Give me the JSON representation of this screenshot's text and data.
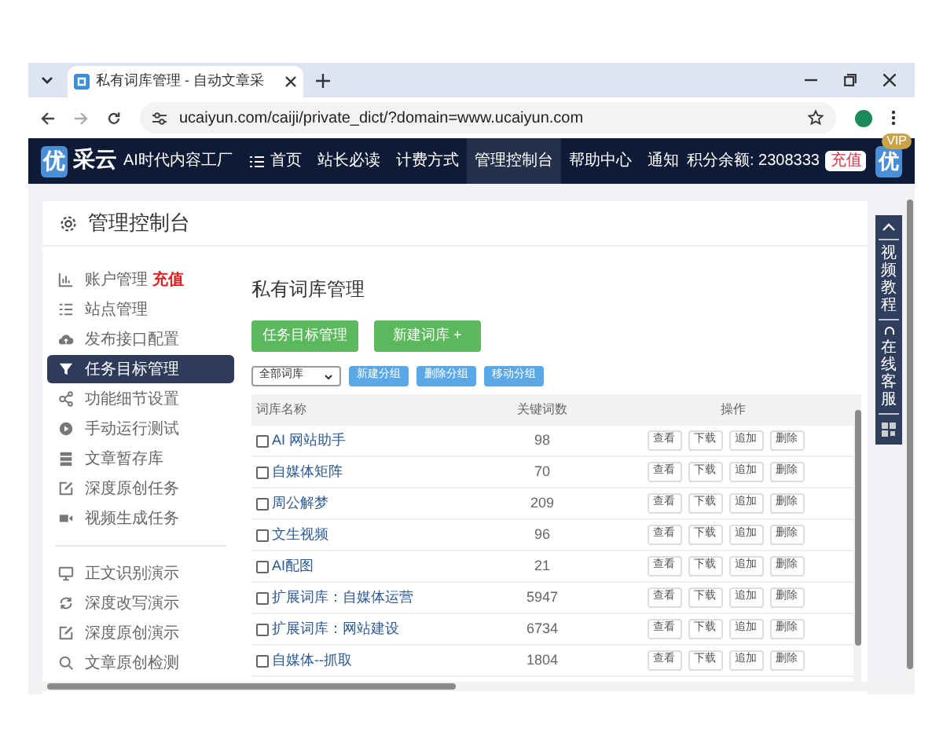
{
  "browser": {
    "tab_title": "私有词库管理 - 自动文章采",
    "url": "ucaiyun.com/caiji/private_dict/?domain=www.ucaiyun.com"
  },
  "nav": {
    "logo_mark": "优",
    "logo_text": "采云",
    "slogan": "AI时代内容工厂",
    "items": [
      {
        "label": "首页",
        "selected": false
      },
      {
        "label": "站长必读",
        "selected": false
      },
      {
        "label": "计费方式",
        "selected": false
      },
      {
        "label": "管理控制台",
        "selected": true
      },
      {
        "label": "帮助中心",
        "selected": false
      },
      {
        "label": "通知",
        "selected": false
      }
    ],
    "balance": "积分余额: 2308333",
    "recharge": "充值",
    "vip_badge": "VIP",
    "avatar": "优"
  },
  "sidebar": {
    "title": "管理控制台",
    "sections": [
      {
        "items": [
          {
            "label": "账户管理",
            "badge": "充值",
            "selected": false
          },
          {
            "label": "站点管理",
            "selected": false
          },
          {
            "label": "发布接口配置",
            "selected": false
          },
          {
            "label": "任务目标管理",
            "selected": true
          },
          {
            "label": "功能细节设置",
            "selected": false
          },
          {
            "label": "手动运行测试",
            "selected": false
          },
          {
            "label": "文章暂存库",
            "selected": false
          },
          {
            "label": "深度原创任务",
            "selected": false
          },
          {
            "label": "视频生成任务",
            "selected": false
          }
        ]
      },
      {
        "items": [
          {
            "label": "正文识别演示",
            "selected": false
          },
          {
            "label": "深度改写演示",
            "selected": false
          },
          {
            "label": "深度原创演示",
            "selected": false
          },
          {
            "label": "文章原创检测",
            "selected": false
          }
        ]
      }
    ]
  },
  "main": {
    "title": "私有词库管理",
    "buttons": [
      "任务目标管理",
      "新建词库 +"
    ],
    "filter": {
      "value": "全部词库"
    },
    "group_buttons": [
      "新建分组",
      "删除分组",
      "移动分组"
    ],
    "table": {
      "columns": [
        "词库名称",
        "关键词数",
        "操作"
      ],
      "rows": [
        {
          "name": "AI 网站助手",
          "count": "98",
          "checked": false,
          "actions": [
            "查看",
            "下载",
            "追加",
            "删除"
          ]
        },
        {
          "name": "自媒体矩阵",
          "count": "70",
          "checked": false,
          "actions": [
            "查看",
            "下载",
            "追加",
            "删除"
          ]
        },
        {
          "name": "周公解梦",
          "count": "209",
          "checked": false,
          "actions": [
            "查看",
            "下载",
            "追加",
            "删除"
          ]
        },
        {
          "name": "文生视频",
          "count": "96",
          "checked": false,
          "actions": [
            "查看",
            "下载",
            "追加",
            "删除"
          ]
        },
        {
          "name": "AI配图",
          "count": "21",
          "checked": false,
          "actions": [
            "查看",
            "下载",
            "追加",
            "删除"
          ]
        },
        {
          "name": "扩展词库：自媒体运营",
          "count": "5947",
          "checked": false,
          "actions": [
            "查看",
            "下载",
            "追加",
            "删除"
          ]
        },
        {
          "name": "扩展词库：网站建设",
          "count": "6734",
          "checked": false,
          "actions": [
            "查看",
            "下载",
            "追加",
            "删除"
          ]
        },
        {
          "name": "自媒体--抓取",
          "count": "1804",
          "checked": false,
          "actions": [
            "查看",
            "下载",
            "追加",
            "删除"
          ]
        }
      ]
    }
  },
  "float_panel": {
    "items": [
      "视频教程",
      "在线客服"
    ]
  }
}
